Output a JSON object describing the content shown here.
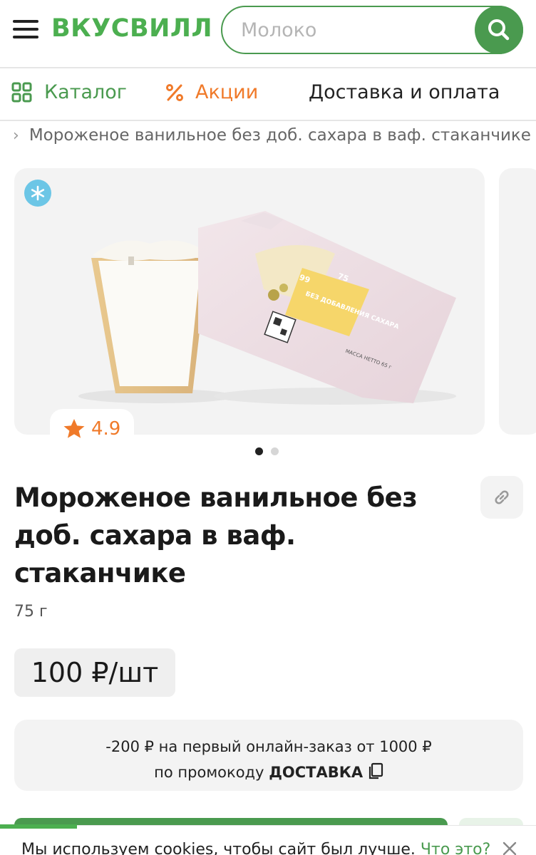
{
  "header": {
    "logo": "ВКУСВИЛЛ",
    "search_placeholder": "Молоко"
  },
  "nav": {
    "catalog": "Каталог",
    "promo": "Акции",
    "delivery": "Доставка и оплата"
  },
  "breadcrumb": {
    "current": "Мороженое ванильное без доб. сахара в ваф. стаканчике"
  },
  "product": {
    "rating": "4.9",
    "title": "Мороженое ванильное без доб. сахара в ваф. стаканчике",
    "weight": "75 г",
    "price": "100 ₽/шт",
    "gallery_slides": 2,
    "gallery_active_slide": 1
  },
  "package_text": {
    "badge": "БЕЗ ДОБАВЛЕНИЯ САХАРА",
    "kcal": "99",
    "grams": "75",
    "net": "МАССА НЕТТО 65 г"
  },
  "promo": {
    "line1": "-200 ₽ на первый онлайн-заказ от 1000 ₽",
    "line2_prefix": "по промокоду",
    "code": "ДОСТАВКА"
  },
  "cookie": {
    "text": "Мы используем cookies, чтобы сайт был лучше.",
    "link": "Что это?"
  },
  "colors": {
    "brand_green": "#4a9a4f",
    "promo_orange": "#f07a2a",
    "snow_badge": "#6cc6e6"
  }
}
